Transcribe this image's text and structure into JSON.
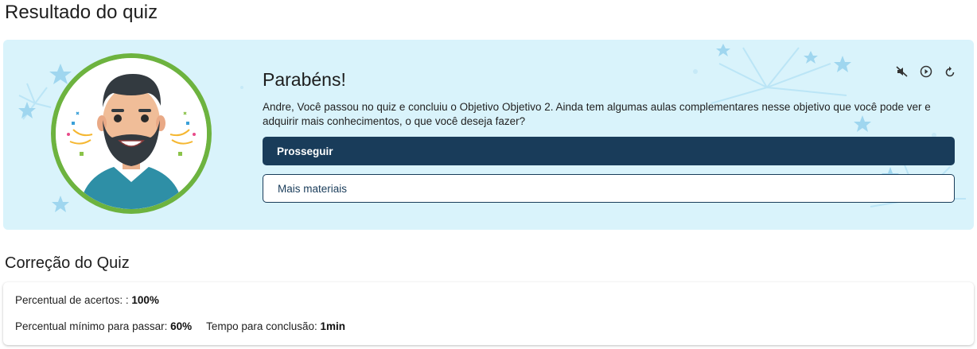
{
  "page": {
    "title": "Resultado do quiz"
  },
  "banner": {
    "heading": "Parabéns!",
    "message": "Andre, Você passou no quiz e concluiu o Objetivo Objetivo 2. Ainda tem algumas aulas complementares nesse objetivo que você pode ver e adquirir mais conhecimentos, o que você deseja fazer?",
    "primary_button": "Prosseguir",
    "secondary_button": "Mais materiais",
    "controls": [
      "mute-icon",
      "play-circle-icon",
      "replay-icon"
    ],
    "colors": {
      "background": "#d9f3fb",
      "primary": "#193c5a",
      "avatar_ring": "#6db33f"
    }
  },
  "correction": {
    "title": "Correção do Quiz",
    "score_label": "Percentual de acertos: :",
    "score_value": "100%",
    "min_label": "Percentual mínimo para passar:",
    "min_value": "60%",
    "time_label": "Tempo para conclusão:",
    "time_value": "1min"
  }
}
